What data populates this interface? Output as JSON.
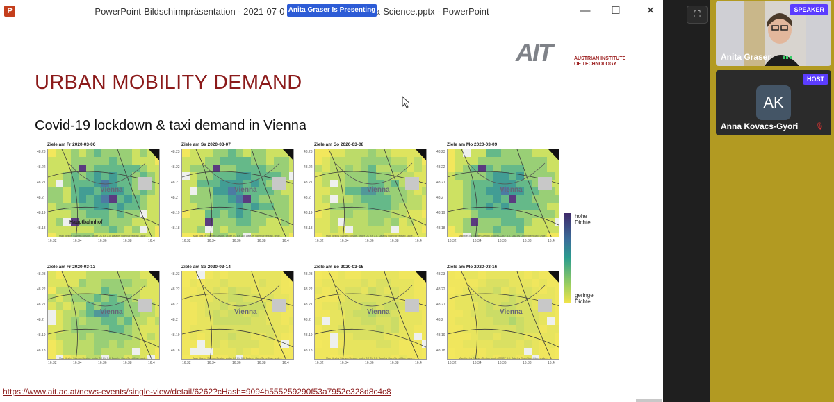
{
  "window": {
    "title_left": "PowerPoint-Bildschirmpräsentation  -  2021-07-0",
    "title_right": "a-Science.pptx - PowerPoint",
    "presenting_badge": "Anita Graser Is Presenting",
    "app_icon": "powerpoint-icon",
    "controls": {
      "minimize": "—",
      "maximize": "☐",
      "close": "✕"
    }
  },
  "slide": {
    "logo": {
      "wordmark": "AIT",
      "line1": "AUSTRIAN INSTITUTE",
      "line2": "OF TECHNOLOGY",
      "color": "#9b1c1c"
    },
    "heading": "URBAN MOBILITY DEMAND",
    "subheading": "Covid-19 lockdown & taxi demand in Vienna",
    "maps": [
      {
        "title": "Ziele am Fr 2020-03-06",
        "city": "Vienna",
        "landmark": "Hauptbahnhof",
        "density": "high"
      },
      {
        "title": "Ziele am Sa 2020-03-07",
        "city": "Vienna",
        "density": "high"
      },
      {
        "title": "Ziele am So 2020-03-08",
        "city": "Vienna",
        "density": "medium"
      },
      {
        "title": "Ziele am Mo 2020-03-09",
        "city": "Vienna",
        "density": "high"
      },
      {
        "title": "Ziele am Fr 2020-03-13",
        "city": "Vienna",
        "density": "medium"
      },
      {
        "title": "Ziele am Sa 2020-03-14",
        "city": "Vienna",
        "density": "low"
      },
      {
        "title": "Ziele am So 2020-03-15",
        "city": "Vienna",
        "density": "low"
      },
      {
        "title": "Ziele am Mo 2020-03-16",
        "city": "Vienna",
        "density": "low"
      }
    ],
    "y_ticks": [
      "48.23",
      "48.22",
      "48.21",
      "48.2",
      "48.19",
      "48.18"
    ],
    "x_ticks": [
      "16.32",
      "16.34",
      "16.36",
      "16.38",
      "16.4"
    ],
    "map_credit": "Map tiles by Stamen Design, under CC BY 3.0. Data by OpenStreetMap, unde...",
    "legend": {
      "high": [
        "hohe",
        "Dichte"
      ],
      "low": [
        "geringe",
        "Dichte"
      ]
    },
    "link": "https://www.ait.ac.at/news-events/single-view/detail/6262?cHash=9094b555259290f53a7952e328d8c4c8"
  },
  "participants": [
    {
      "name": "Anita Graser",
      "role_badge": "SPEAKER",
      "video": "camera-on",
      "mic": "active"
    },
    {
      "name": "Anna Kovacs-Gyori",
      "role_badge": "HOST",
      "initials": "AK",
      "video": "camera-off",
      "mic": "muted"
    }
  ],
  "colors": {
    "heading": "#8b1a1a",
    "badge": "#5b3cff",
    "presenting": "#2d5cd6",
    "sidebar": "#b29a22"
  }
}
